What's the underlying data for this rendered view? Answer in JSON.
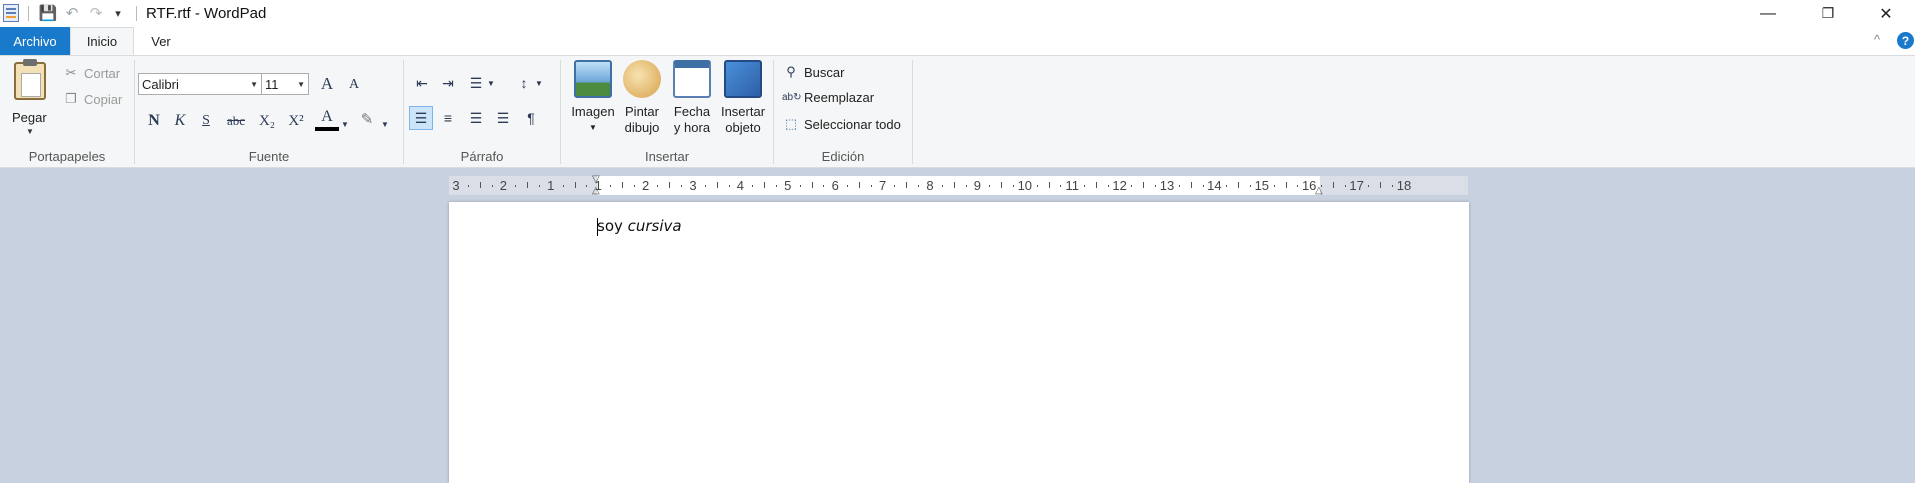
{
  "window": {
    "title": "RTF.rtf - WordPad"
  },
  "quick_access": {
    "save": "💾",
    "undo": "↶",
    "redo": "↷",
    "customize": "▾"
  },
  "window_controls": {
    "minimize": "—",
    "restore": "❐",
    "close": "✕"
  },
  "tabs": {
    "file": "Archivo",
    "home": "Inicio",
    "view": "Ver"
  },
  "ribbon_controls": {
    "collapse": "^",
    "help": "?"
  },
  "clipboard": {
    "group_label": "Portapapeles",
    "paste": "Pegar",
    "cut": "Cortar",
    "copy": "Copiar"
  },
  "font": {
    "group_label": "Fuente",
    "family": "Calibri",
    "size": "11",
    "grow": "A",
    "shrink": "A",
    "bold": "N",
    "italic": "K",
    "underline": "S",
    "strikethrough": "abc",
    "subscript": "X₂",
    "superscript": "X²",
    "color": "A",
    "highlight": "✎"
  },
  "paragraph": {
    "group_label": "Párrafo"
  },
  "insert": {
    "group_label": "Insertar",
    "image_l1": "Imagen",
    "paint_l1": "Pintar",
    "paint_l2": "dibujo",
    "datetime_l1": "Fecha",
    "datetime_l2": "y hora",
    "object_l1": "Insertar",
    "object_l2": "objeto"
  },
  "editing": {
    "group_label": "Edición",
    "find": "Buscar",
    "replace": "Reemplazar",
    "select_all": "Seleccionar todo"
  },
  "ruler": {
    "labels": [
      "3",
      "2",
      "1",
      "1",
      "2",
      "3",
      "4",
      "5",
      "6",
      "7",
      "8",
      "9",
      "10",
      "11",
      "12",
      "13",
      "14",
      "15",
      "16",
      "17",
      "18"
    ]
  },
  "document": {
    "normal_text": "soy ",
    "italic_text": "cursiva"
  },
  "colors": {
    "accent": "#1979ca",
    "ribbon": "#f5f6f7",
    "workspace": "#c8d1e0"
  }
}
